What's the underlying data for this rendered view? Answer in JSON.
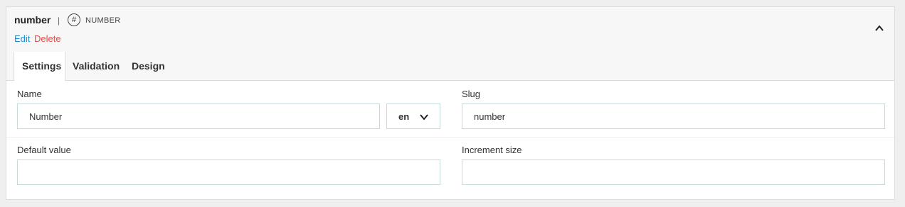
{
  "header": {
    "field_name": "number",
    "separator": "|",
    "type_icon_glyph": "#",
    "type_icon": "hash-icon",
    "type_label": "NUMBER",
    "edit_label": "Edit",
    "delete_label": "Delete",
    "collapse_icon": "chevron-up-icon"
  },
  "tabs": [
    {
      "label": "Settings",
      "active": true
    },
    {
      "label": "Validation",
      "active": false
    },
    {
      "label": "Design",
      "active": false
    }
  ],
  "form": {
    "name": {
      "label": "Name",
      "value": "Number"
    },
    "locale": {
      "value": "en",
      "icon": "chevron-down-icon"
    },
    "slug": {
      "label": "Slug",
      "value": "number"
    },
    "default_value": {
      "label": "Default value",
      "value": ""
    },
    "increment_size": {
      "label": "Increment size",
      "value": ""
    }
  },
  "colors": {
    "link": "#1d8fd1",
    "danger": "#e04d4d",
    "input_border": "#c5dada"
  }
}
